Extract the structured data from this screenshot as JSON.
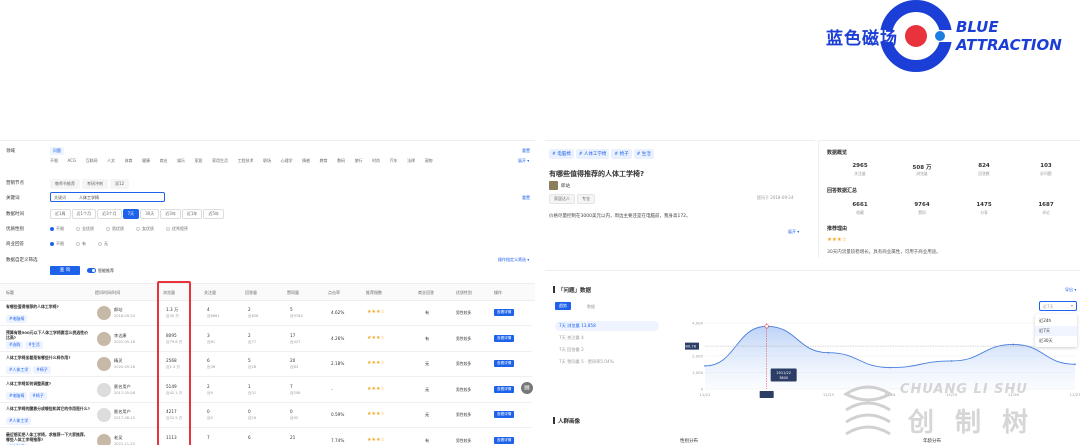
{
  "brand": {
    "cn_name": "蓝色磁场",
    "en_line1": "BLUE",
    "en_line2": "ATTRACTION",
    "color": "#1b3fd6",
    "accent": "#e8323c"
  },
  "watermark": {
    "text": "CHUANG LI SHU",
    "cn": "创 制 树"
  },
  "filters": {
    "domain_label": "领域",
    "domain_selected": "问题",
    "domain_tabs": [
      "不限",
      "ACG",
      "互联网",
      "人文",
      "体育",
      "健康",
      "商业",
      "娱乐",
      "家居",
      "家用生活",
      "工程技术",
      "职场",
      "心理学",
      "情感",
      "教育",
      "数码",
      "旅行",
      "时尚",
      "汽车",
      "法律",
      "宠物"
    ],
    "reset_label": "重置",
    "expand_label": "展开 ▾",
    "tag_label": "营销节点",
    "tag_options": [
      "教师节推荐",
      "考研冲刺",
      "双12"
    ],
    "keyword_label": "关键词",
    "keyword_type": "关键词",
    "keyword_value": "人体工学椅",
    "keyword_reset": "重置",
    "time_label": "数据时间",
    "time_options": [
      "近1周",
      "近1个月",
      "近3个月",
      "7天",
      "30天",
      "近3年",
      "近1年",
      "近5年"
    ],
    "time_selected": "7天",
    "gender_label": "优质性别",
    "gender_options": [
      "不限",
      "全优质",
      "男优质",
      "女优质",
      "优秀程序"
    ],
    "commercial_label": "商业回答",
    "commercial_options": [
      "不限",
      "有",
      "无"
    ],
    "custom_label": "数据自定义筛选",
    "query_button": "查 询",
    "smart_toggle": "智能推荐",
    "export_link": "操作指定义筛选 ▾"
  },
  "table": {
    "columns": [
      "标题",
      "提问时间/时间",
      "浏览量",
      "关注量",
      "回答量",
      "赞同量",
      "点击率",
      "推荐指数",
      "商业回答",
      "优质性别",
      "操作"
    ],
    "view_label": "查看详情",
    "rows": [
      {
        "title": "有哪些值得推荐的人体工学椅?",
        "tags": [
          "#电脑椅"
        ],
        "author": "郎站",
        "date": "2018-09-24",
        "views": "1.3 万",
        "views_sub": "近30 万",
        "follow": "4",
        "follow_sub": "近6681",
        "answers": "2",
        "answers_sub": "近828",
        "likes": "5",
        "likes_sub": "近9764",
        "ctr": "4.62%",
        "stars": "★★★☆",
        "commercial": "有",
        "gender": "男性较多"
      },
      {
        "title": "预算有限500元以下人体工学椅要怎么挑选性价比高?",
        "tags": [
          "#选购",
          "#生活"
        ],
        "author": "李达康",
        "date": "2022-05-18",
        "views": "8095",
        "views_sub": "近79.6 万",
        "follow": "3",
        "follow_sub": "近81",
        "answers": "2",
        "answers_sub": "近77",
        "likes": "17",
        "likes_sub": "近427",
        "ctr": "4.26%",
        "stars": "★★★☆",
        "commercial": "有",
        "gender": "男性较多"
      },
      {
        "title": "人体工学椅坐着是有哪些什么样作用?",
        "tags": [
          "#人体工学",
          "#椅子"
        ],
        "author": "精灵",
        "date": "2020-09-28",
        "views": "2568",
        "views_sub": "近1.3 万",
        "follow": "6",
        "follow_sub": "近36",
        "answers": "5",
        "answers_sub": "近28",
        "likes": "20",
        "likes_sub": "近83",
        "ctr": "2.18%",
        "stars": "★★★☆",
        "commercial": "无",
        "gender": "男性较多"
      },
      {
        "title": "人体工学椅如何调整高度?",
        "tags": [
          "#电脑椅",
          "#椅子"
        ],
        "author": "匿名用户",
        "date": "2017-05-08",
        "views": "5149",
        "views_sub": "近42.1 万",
        "follow": "2",
        "follow_sub": "近9",
        "answers": "1",
        "answers_sub": "近31",
        "likes": "7",
        "likes_sub": "近208",
        "ctr": "-",
        "stars": "★★★☆",
        "commercial": "无",
        "gender": "男性较多"
      },
      {
        "title": "人体工学椅的腰靠分成哪些和其它的作用是什么?",
        "tags": [
          "#人体工学"
        ],
        "author": "匿名用户",
        "date": "2017-08-15",
        "views": "4217",
        "views_sub": "近32.5 万",
        "follow": "0",
        "follow_sub": "近0",
        "answers": "0",
        "answers_sub": "近18",
        "likes": "0",
        "likes_sub": "近92",
        "ctr": "0.59%",
        "stars": "★★★☆",
        "commercial": "无",
        "gender": "男性较多"
      },
      {
        "title": "最近想买把人体工学椅，求推荐一下大家推荐，哪些人体工学椅推荐?",
        "tags": [
          "#电脑椅"
        ],
        "author": "老吴",
        "date": "2021-11-20",
        "views": "1113",
        "views_sub": "",
        "follow": "7",
        "follow_sub": "",
        "answers": "6",
        "answers_sub": "",
        "likes": "21",
        "likes_sub": "",
        "ctr": "7.74%",
        "stars": "★★★☆",
        "commercial": "有",
        "gender": "男性较多"
      }
    ]
  },
  "question": {
    "tags": [
      "# 电脑椅",
      "# 人体工学椅",
      "# 椅子",
      "# 生活"
    ],
    "title": "有哪些值得推荐的人体工学椅?",
    "author": "郎站",
    "author_tags": [
      "家居达人",
      "专业"
    ],
    "created": "提问于 2018-09-24",
    "desc": "价格尽量控制在3000美元以内，周边主要还是在电脑前，我身高172。",
    "expand": "展开 ▾"
  },
  "overview": {
    "title": "数据概览",
    "stats": [
      {
        "value": "2965",
        "label": "关注量"
      },
      {
        "value": "508 万",
        "label": "浏览量"
      },
      {
        "value": "824",
        "label": "回答数"
      },
      {
        "value": "103",
        "label": "好问题"
      }
    ],
    "answers_title": "回答数据汇总",
    "answer_stats": [
      {
        "value": "6661",
        "label": "收藏"
      },
      {
        "value": "9764",
        "label": "赞同"
      },
      {
        "value": "1475",
        "label": "分享"
      },
      {
        "value": "1687",
        "label": "评论"
      }
    ],
    "reason_title": "推荐理由",
    "reason_stars": "★★★☆",
    "reason_text": "30天内流量较稳增长。具有商业属性，可用于商业用途。"
  },
  "trend": {
    "title": "「问题」数据",
    "download": "导出 ▾",
    "tabs": [
      "趋势",
      "数据"
    ],
    "metrics": [
      "7天 浏览量 13,858",
      "7天 关注量 4",
      "7天 回答量 2",
      "7天 赞同量 5 · 赞同率5.04%"
    ],
    "range_placeholder": "近7天",
    "range_options": [
      "近24h",
      "近7天",
      "近30天"
    ],
    "y_ticks": [
      "4,000",
      "2,000",
      "1,000",
      "0"
    ],
    "x_ticks": [
      "11/21",
      "11/22",
      "11/23",
      "11/24",
      "11/25",
      "11/26",
      "11/27"
    ],
    "cursor_value": "2,600.78",
    "tooltip_date": "2011/22",
    "tooltip_value": "3800"
  },
  "chart_data": {
    "type": "area",
    "x": [
      "11/21",
      "11/22",
      "11/23",
      "11/24",
      "11/25",
      "11/26",
      "11/27"
    ],
    "values": [
      1400,
      3800,
      2200,
      1300,
      1700,
      2700,
      1500
    ],
    "ylim": [
      0,
      4000
    ]
  },
  "demographics": {
    "title": "人群画像",
    "gender_title": "性别分布",
    "age_title": "年龄分布"
  }
}
